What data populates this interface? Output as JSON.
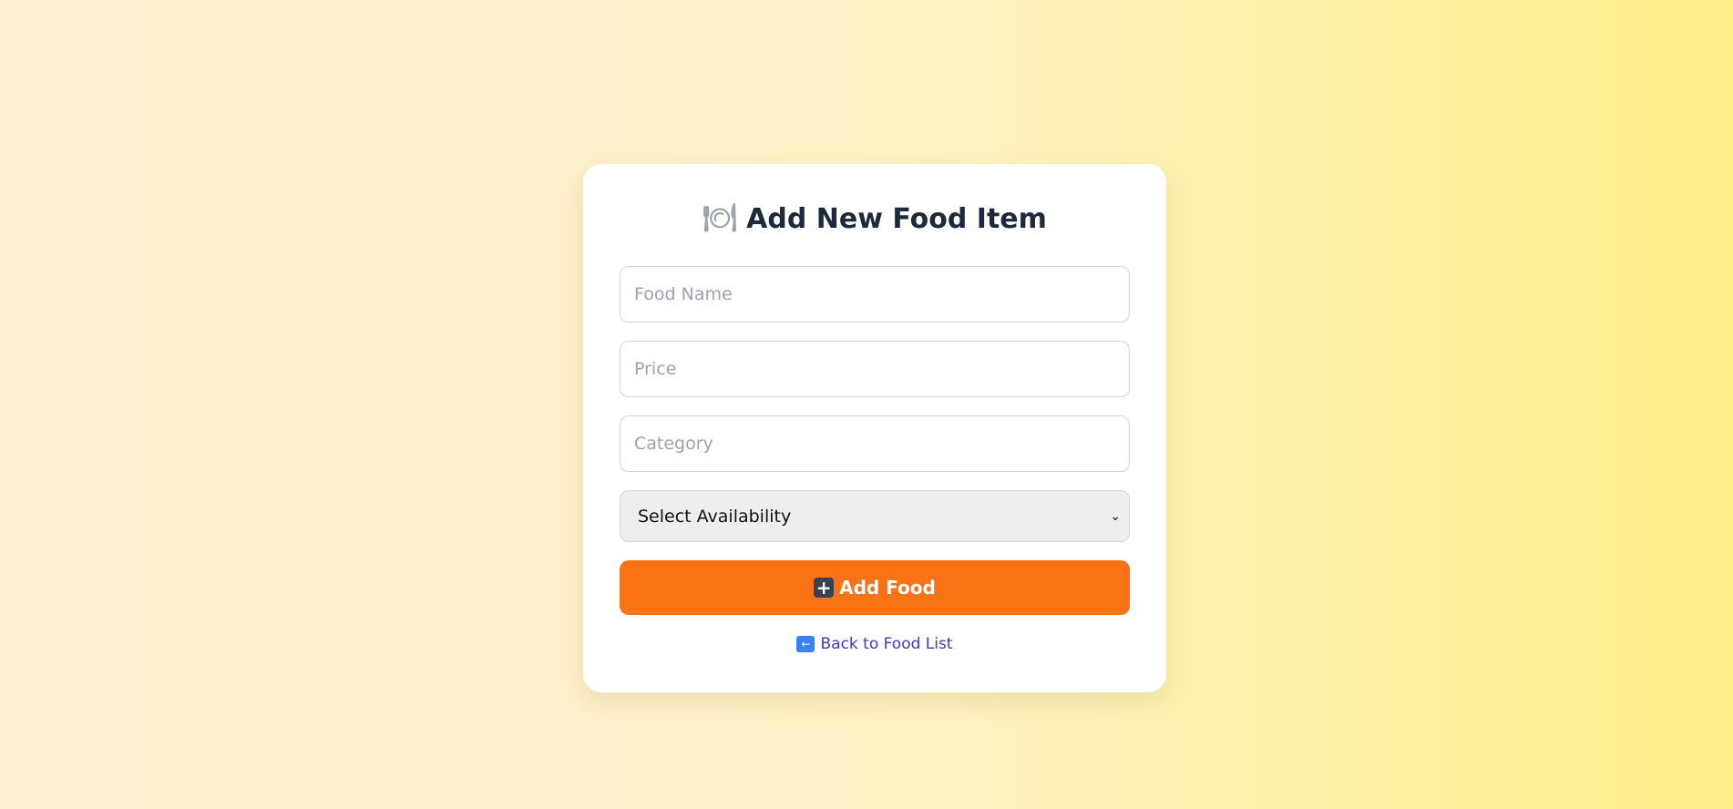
{
  "form": {
    "title": "Add New Food Item",
    "title_icon": "plate-cutlery-icon",
    "food_name_placeholder": "Food Name",
    "price_placeholder": "Price",
    "category_placeholder": "Category",
    "availability_selected": "Select Availability",
    "submit_label": "Add Food",
    "submit_icon": "plus-icon",
    "back_label": "Back to Food List",
    "back_icon": "back-arrow-icon"
  },
  "colors": {
    "accent": "#f97316",
    "link": "#4338ca",
    "title": "#1e293b"
  }
}
